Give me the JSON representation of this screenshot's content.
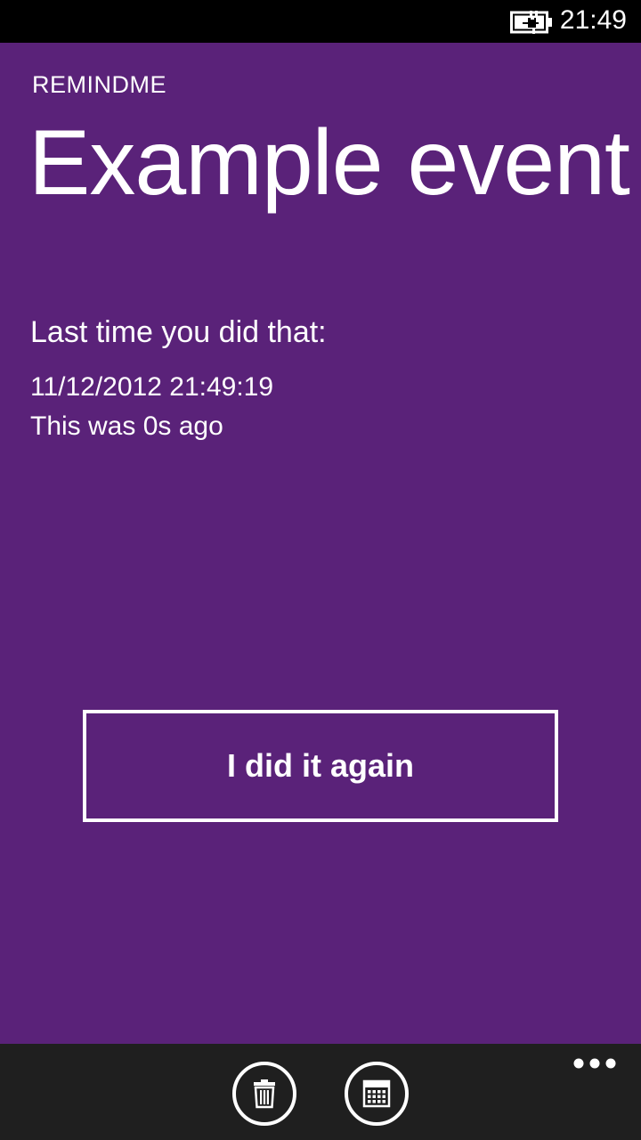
{
  "status_bar": {
    "time": "21:49",
    "battery_icon": "battery-charging-icon"
  },
  "app": {
    "name": "REMINDME",
    "title": "Example event"
  },
  "details": {
    "last_label": "Last time you did that:",
    "date": "11/12/2012 21:49:19",
    "ago": "This was 0s ago"
  },
  "actions": {
    "again_label": "I did it again"
  },
  "app_bar": {
    "buttons": [
      {
        "icon": "trash-icon"
      },
      {
        "icon": "calendar-icon"
      }
    ],
    "more_icon": "ellipsis-icon"
  },
  "colors": {
    "accent_background": "#5a2279",
    "app_bar_background": "#1f1f1f",
    "status_bar_background": "#000000",
    "foreground": "#ffffff"
  }
}
